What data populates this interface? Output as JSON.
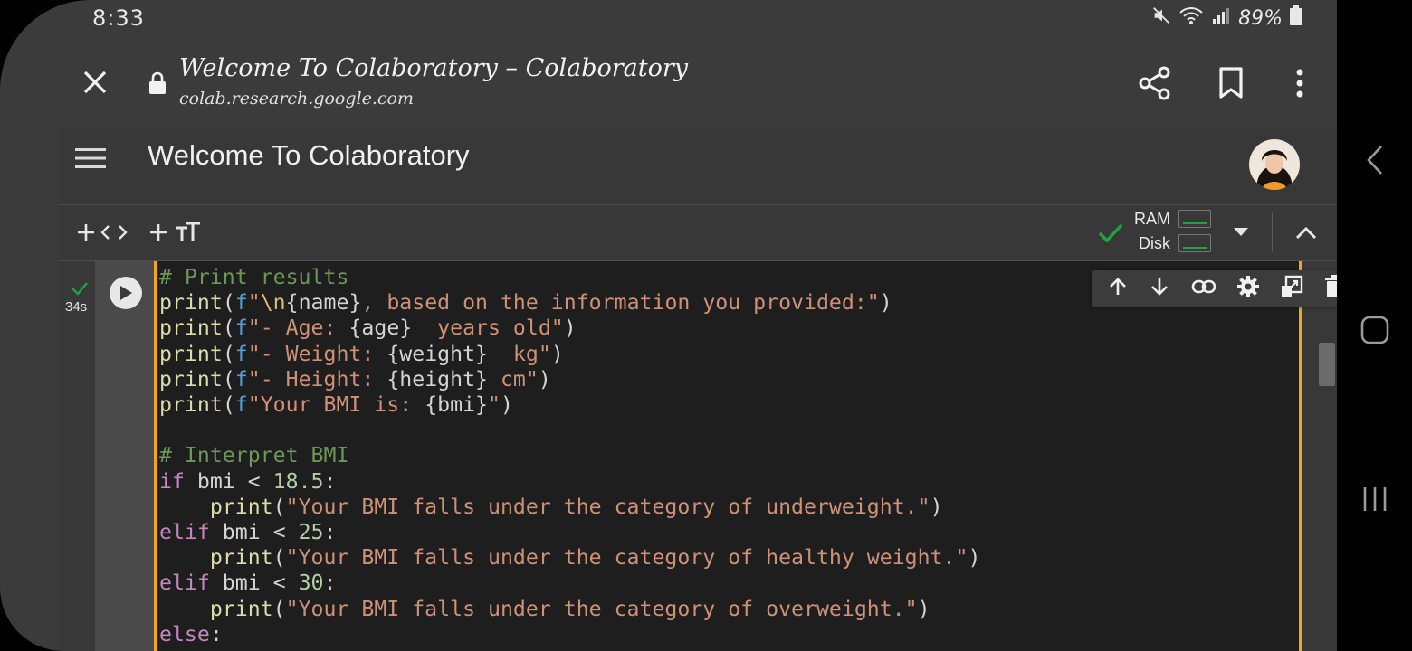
{
  "status_bar": {
    "time": "8:33",
    "battery": "89%"
  },
  "browser": {
    "title": "Welcome To Colaboratory – Colaboratory",
    "url": "colab.research.google.com"
  },
  "colab": {
    "notebook_title": "Welcome To Colaboratory",
    "toolbar": {
      "add_code_icon": "plus-code-icon",
      "add_text_icon": "plus-text-icon",
      "ram_label": "RAM",
      "disk_label": "Disk",
      "connected_color": "#1ea446"
    }
  },
  "cell": {
    "exec_time": "34s",
    "code_lines": [
      "# Print results",
      "print(f\"\\n{name}, based on the information you provided:\")",
      "print(f\"- Age: {age}  years old\")",
      "print(f\"- Weight: {weight}  kg\")",
      "print(f\"- Height: {height} cm\")",
      "print(f\"Your BMI is: {bmi}\")",
      "",
      "# Interpret BMI",
      "if bmi < 18.5:",
      "    print(\"Your BMI falls under the category of underweight.\")",
      "elif bmi < 25:",
      "    print(\"Your BMI falls under the category of healthy weight.\")",
      "elif bmi < 30:",
      "    print(\"Your BMI falls under the category of overweight.\")",
      "else:"
    ],
    "toolbar_icons": [
      "arrow-up-icon",
      "arrow-down-icon",
      "link-icon",
      "gear-icon",
      "mirror-cell-icon",
      "trash-icon",
      "more-vert-icon"
    ]
  },
  "colors": {
    "accent_border": "#f1a71d",
    "comment": "#6a9955",
    "string": "#ce9178",
    "keyword": "#c586c0"
  }
}
